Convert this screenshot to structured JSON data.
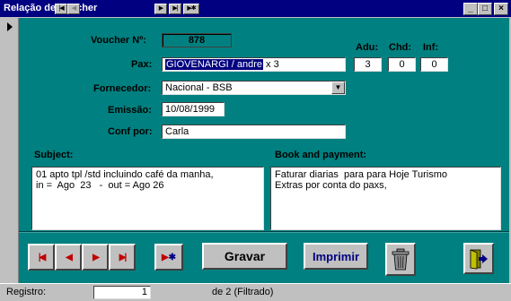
{
  "window": {
    "title": "Relação de Voucher"
  },
  "form": {
    "voucher_label": "Voucher Nº:",
    "voucher_value": "878",
    "pax_label": "Pax:",
    "pax_selected": "GIOVENARGI / andre",
    "pax_rest": " x 3",
    "adu_label": "Adu:",
    "adu_value": "3",
    "chd_label": "Chd:",
    "chd_value": "0",
    "inf_label": "Inf:",
    "inf_value": "0",
    "fornecedor_label": "Fornecedor:",
    "fornecedor_value": "Nacional - BSB",
    "emissao_label": "Emissão:",
    "emissao_value": "10/08/1999",
    "confpor_label": "Conf por:",
    "confpor_value": "Carla",
    "subject_label": "Subject:",
    "subject_text": "01 apto tpl /std incluindo café da manha,\nin =  Ago  23   -  out = Ago 26",
    "book_label": "Book and payment:",
    "book_text": "Faturar diarias  para para Hoje Turismo\nExtras por conta do paxs,"
  },
  "buttons": {
    "gravar": "Gravar",
    "imprimir": "Imprimir"
  },
  "statusbar": {
    "registro_label": "Registro:",
    "record_value": "1",
    "of_text": "de  2 (Filtrado)"
  }
}
